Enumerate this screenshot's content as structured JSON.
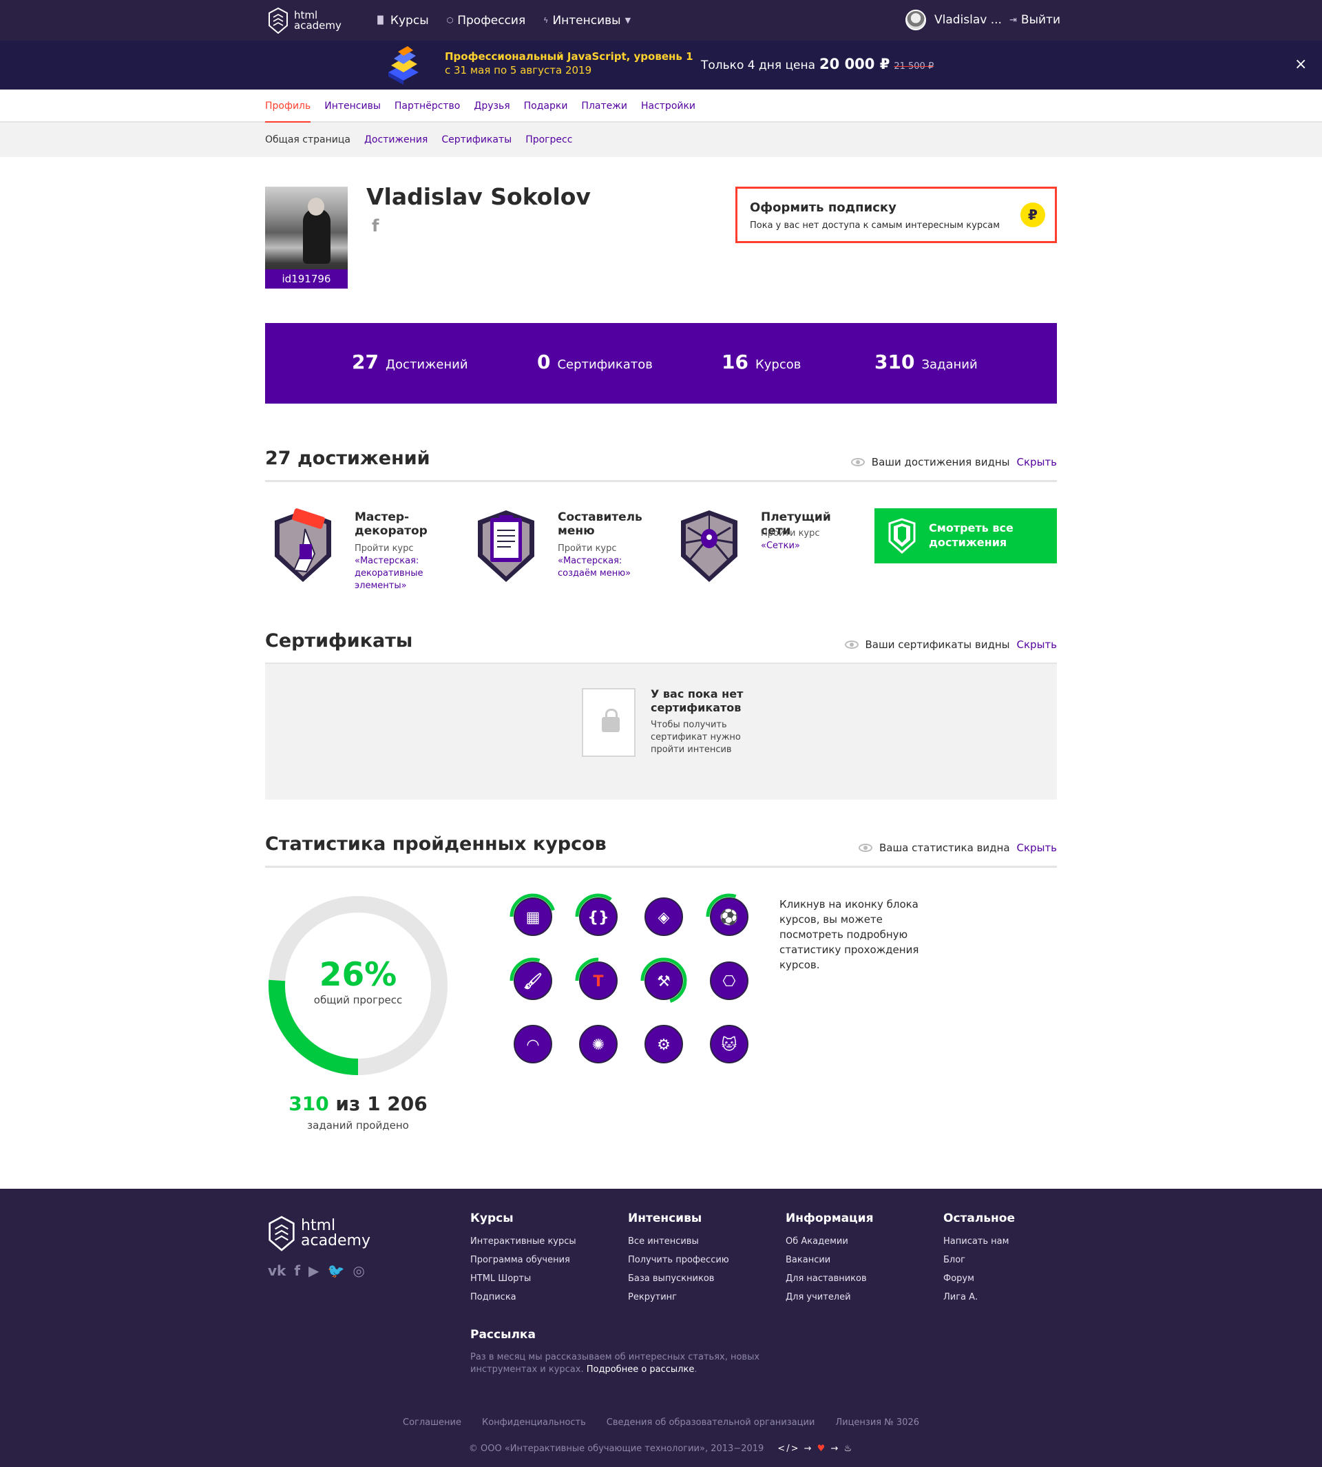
{
  "header": {
    "logo_line1": "html",
    "logo_line2": "academy",
    "nav": [
      {
        "label": "Курсы",
        "icon": "bar-chart-icon"
      },
      {
        "label": "Профессия",
        "icon": "graduation-cap-icon"
      },
      {
        "label": "Интенсивы",
        "icon": "lightning-icon"
      }
    ],
    "user_name": "Vladislav ...",
    "logout_label": "Выйти"
  },
  "promo": {
    "title": "Профессиональный JavaScript, уровень 1",
    "dates": "с 31 мая по 5 августа 2019",
    "price_prefix": "Только 4 дня цена",
    "price": "20 000 ₽",
    "old_price": "21 500 ₽",
    "close": "×"
  },
  "tabs": [
    "Профиль",
    "Интенсивы",
    "Партнёрство",
    "Друзья",
    "Подарки",
    "Платежи",
    "Настройки"
  ],
  "subtabs": [
    "Общая страница",
    "Достижения",
    "Сертификаты",
    "Прогресс"
  ],
  "profile": {
    "name": "Vladislav Sokolov",
    "id": "id191796",
    "social_icon": "f"
  },
  "subscribe": {
    "title": "Оформить подписку",
    "text": "Пока у вас нет доступа к самым интересным курсам",
    "icon_glyph": "₽"
  },
  "stats": [
    {
      "value": "27",
      "label": "Достижений"
    },
    {
      "value": "0",
      "label": "Сертификатов"
    },
    {
      "value": "16",
      "label": "Курсов"
    },
    {
      "value": "310",
      "label": "Заданий"
    }
  ],
  "achievements": {
    "title": "27 достижений",
    "visibility": "Ваши достижения видны",
    "hide": "Скрыть",
    "items": [
      {
        "title": "Мастер-декоратор",
        "desc": "Пройти курс",
        "link": "«Мастерская: декоративные элементы»"
      },
      {
        "title": "Составитель меню",
        "desc": "Пройти курс",
        "link": "«Мастерская: создаём меню»"
      },
      {
        "title": "Плетущий сети",
        "desc": "Пройти курс",
        "link": "«Сетки»"
      }
    ],
    "see_all": "Смотреть все достижения"
  },
  "certificates": {
    "title": "Сертификаты",
    "visibility": "Ваши сертификаты видны",
    "hide": "Скрыть",
    "empty_title": "У вас пока нет сертификатов",
    "empty_text": "Чтобы получить сертификат нужно пройти интенсив"
  },
  "course_stats": {
    "title": "Статистика пройденных курсов",
    "visibility": "Ваша статистика видна",
    "hide": "Скрыть",
    "percent": "26%",
    "percent_value": 0.26,
    "percent_label": "общий прогресс",
    "done": "310",
    "total_text": " из 1 206",
    "done_label": "заданий пройдено",
    "hint": "Кликнув на иконку блока курсов, вы можете посмотреть подробную статистику прохождения курсов.",
    "blocks": [
      {
        "name": "course-block-html-icon",
        "progress": 0.45
      },
      {
        "name": "course-block-js-icon",
        "progress": 0.35
      },
      {
        "name": "course-block-cube-icon",
        "progress": 0.0
      },
      {
        "name": "course-block-field-icon",
        "progress": 0.3
      },
      {
        "name": "course-block-paint-icon",
        "progress": 0.3
      },
      {
        "name": "course-block-typography-icon",
        "progress": 0.25
      },
      {
        "name": "course-block-anvil-icon",
        "progress": 0.7
      },
      {
        "name": "course-block-device-icon",
        "progress": 0.0
      },
      {
        "name": "course-block-vector-icon",
        "progress": 0.0
      },
      {
        "name": "course-block-orbit-icon",
        "progress": 0.0
      },
      {
        "name": "course-block-tools-icon",
        "progress": 0.0
      },
      {
        "name": "course-block-cat-icon",
        "progress": 0.0
      }
    ]
  },
  "footer": {
    "logo_line1": "html",
    "logo_line2": "academy",
    "social": [
      "vk",
      "f",
      "▶",
      "🐦",
      "◎"
    ],
    "columns": [
      {
        "title": "Курсы",
        "items": [
          "Интерактивные курсы",
          "Программа обучения",
          "HTML Шорты",
          "Подписка"
        ]
      },
      {
        "title": "Интенсивы",
        "items": [
          "Все интенсивы",
          "Получить профессию",
          "База выпускников",
          "Рекрутинг"
        ]
      },
      {
        "title": "Информация",
        "items": [
          "Об Академии",
          "Вакансии",
          "Для наставников",
          "Для учителей"
        ]
      },
      {
        "title": "Остальное",
        "items": [
          "Написать нам",
          "Блог",
          "Форум",
          "Лига А."
        ]
      }
    ],
    "newsletter_title": "Рассылка",
    "newsletter_text": "Раз в месяц мы рассказываем об интересных статьях, новых инструментах и курсах.",
    "newsletter_link": "Подробнее о рассылке",
    "legal": [
      "Соглашение",
      "Конфиденциальность",
      "Сведения об образовательной организации",
      "Лицензия № 3026"
    ],
    "copyright": "© ООО «Интерактивные обучающие технологии», 2013−2019",
    "glyphs_code": "</>",
    "glyphs_arrow": "→",
    "glyphs_heart": "♥",
    "glyphs_end": "→ ♨"
  },
  "colors": {
    "brand_purple": "#5300a0",
    "accent_red": "#ff3e2e",
    "green": "#00c940",
    "dark": "#2b2145"
  }
}
